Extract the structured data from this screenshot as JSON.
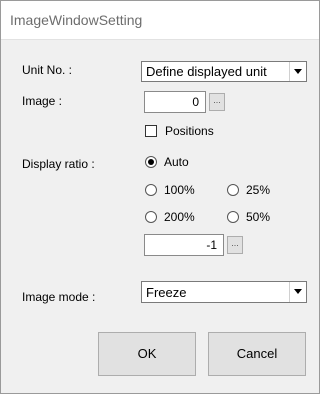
{
  "window": {
    "title": "ImageWindowSetting"
  },
  "form": {
    "unit_no_label": "Unit No. :",
    "unit_no_value": "Define displayed unit",
    "image_label": "Image :",
    "image_value": "0",
    "image_browse": "...",
    "positions_label": "Positions",
    "positions_checked": false,
    "display_ratio_label": "Display ratio :",
    "ratio_options": [
      "Auto",
      "100%",
      "25%",
      "200%",
      "50%"
    ],
    "ratio_selected": "Auto",
    "ratio_value": "-1",
    "ratio_browse": "...",
    "image_mode_label": "Image mode :",
    "image_mode_value": "Freeze"
  },
  "buttons": {
    "ok": "OK",
    "cancel": "Cancel"
  }
}
